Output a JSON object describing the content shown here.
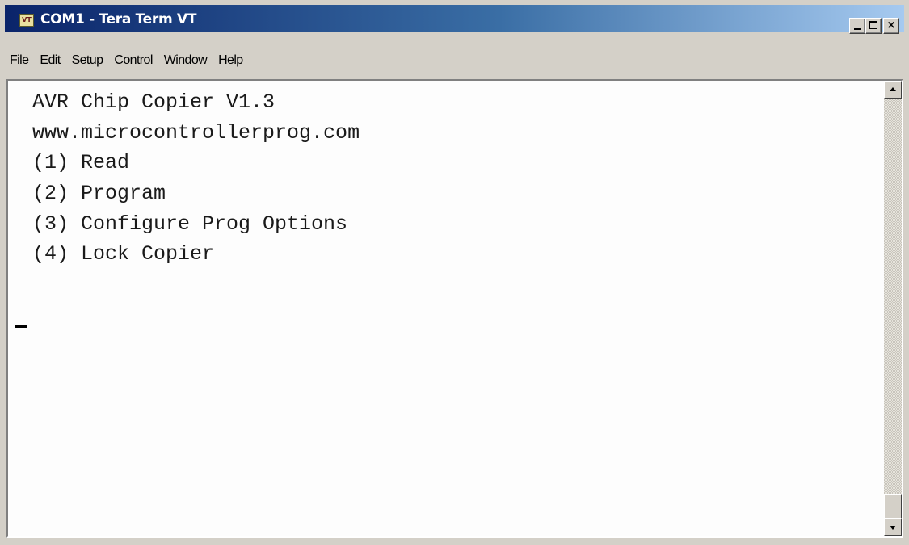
{
  "window": {
    "title": "COM1 - Tera Term VT",
    "icon_text": "VT",
    "icon": "teraterm-app-icon"
  },
  "menubar": {
    "items": [
      {
        "label": "File"
      },
      {
        "label": "Edit"
      },
      {
        "label": "Setup"
      },
      {
        "label": "Control"
      },
      {
        "label": "Window"
      },
      {
        "label": "Help"
      }
    ]
  },
  "terminal": {
    "lines": [
      "AVR Chip Copier V1.3",
      "www.microcontrollerprog.com",
      "(1) Read",
      "(2) Program",
      "(3) Configure Prog Options",
      "(4) Lock Copier"
    ]
  },
  "colors": {
    "titlebar_start": "#0a246a",
    "titlebar_end": "#a6caf0",
    "chrome": "#d4d0c8",
    "terminal_bg": "#fdfdfd",
    "terminal_text": "#1a1a1a"
  }
}
